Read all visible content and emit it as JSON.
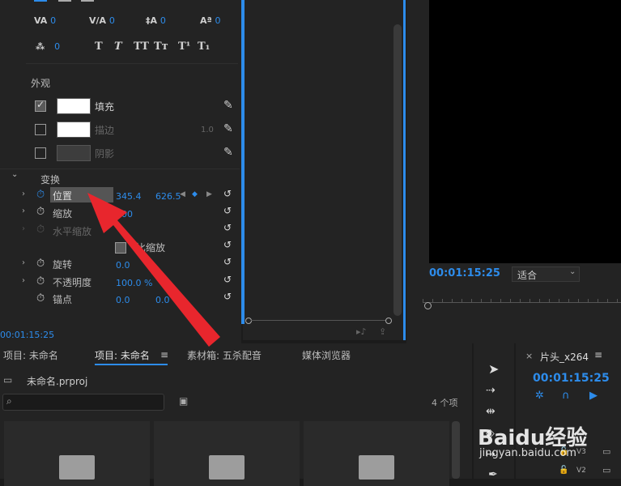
{
  "text_panel": {
    "row1": [
      {
        "icon": "tracking-icon",
        "value": "0"
      },
      {
        "icon": "kerning-icon",
        "value": "0"
      },
      {
        "icon": "leading-icon",
        "value": "0"
      },
      {
        "icon": "baseline-icon",
        "value": "0"
      }
    ],
    "row2_value": "0",
    "styles": [
      "T",
      "T",
      "TT",
      "Tт",
      "T¹",
      "T₁"
    ],
    "appearance_header": "外观",
    "fill_label": "填充",
    "stroke_label": "描边",
    "stroke_value": "1.0",
    "shadow_label": "阴影",
    "transform_header": "变换",
    "position_label": "位置",
    "position_x": "345.4",
    "position_y": "626.5",
    "scale_label": "缩放",
    "scale_value": "100",
    "hscale_label": "水平缩放",
    "uniform_label": "比缩放",
    "rotation_label": "旋转",
    "rotation_value": "0.0",
    "opacity_label": "不透明度",
    "opacity_value": "100.0 %",
    "anchor_label": "锚点",
    "anchor_x": "0.0",
    "anchor_y": "0.0",
    "timecode": "00:01:15:25"
  },
  "program": {
    "timecode": "00:01:15:25",
    "fit_label": "适合"
  },
  "project": {
    "tabs": [
      "项目: 未命名",
      "项目: 未命名",
      "素材箱: 五杀配音",
      "媒体浏览器"
    ],
    "file_name": "未命名.prproj",
    "search_placeholder": "",
    "item_count": "4 个项"
  },
  "timeline": {
    "title": "片头_x264",
    "timecode": "00:01:15:25",
    "track_v3": "V3",
    "track_v2": "V2"
  },
  "watermark": {
    "brand": "Baidu经验",
    "url": "jingyan.baidu.com"
  },
  "colors": {
    "accent": "#2d8ceb",
    "arrow": "#e8262d"
  }
}
